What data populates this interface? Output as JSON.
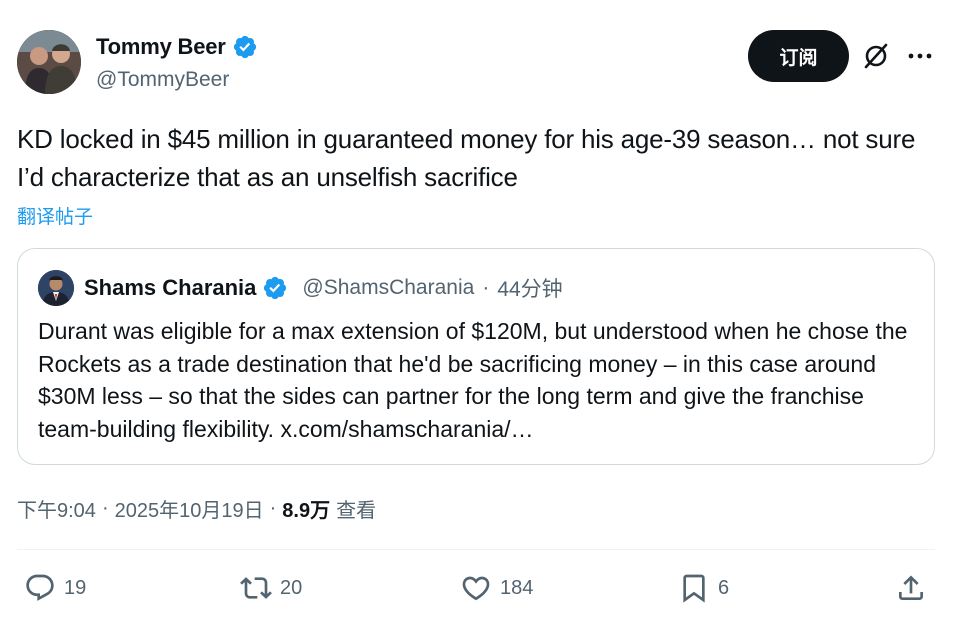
{
  "author": {
    "name": "Tommy Beer",
    "handle": "@TommyBeer",
    "subscribe_label": "订阅"
  },
  "tweet": {
    "text": "KD locked in $45 million in guaranteed money for his age-39 season… not sure I’d characterize that as an unselfish sacrifice",
    "translate_label": "翻译帖子"
  },
  "quoted_tweet": {
    "name": "Shams Charania",
    "handle": "@ShamsCharania",
    "separator": "·",
    "time": "44分钟",
    "text": "Durant was eligible for a max extension of $120M, but understood when he chose the Rockets as a trade destination that he'd be sacrificing money – in this case around $30M less – so that the sides can partner for the long term and give the franchise team-building flexibility. x.com/shamscharania/…"
  },
  "meta": {
    "time": "下午9:04",
    "separator": "·",
    "date": "2025年10月19日",
    "separator2": "·",
    "views_count": "8.9万",
    "views_label": "查看"
  },
  "actions": {
    "replies": "19",
    "retweets": "20",
    "likes": "184",
    "bookmarks": "6"
  },
  "icons": {
    "verified": "verified-badge-icon",
    "grok": "grok-icon",
    "more": "more-icon",
    "reply": "reply-icon",
    "retweet": "retweet-icon",
    "like": "heart-icon",
    "bookmark": "bookmark-icon",
    "share": "share-icon"
  },
  "colors": {
    "text": "#0f1419",
    "secondary": "#536471",
    "accent": "#1d9bf0",
    "border": "#cfd9de",
    "button_bg": "#0f1419"
  }
}
